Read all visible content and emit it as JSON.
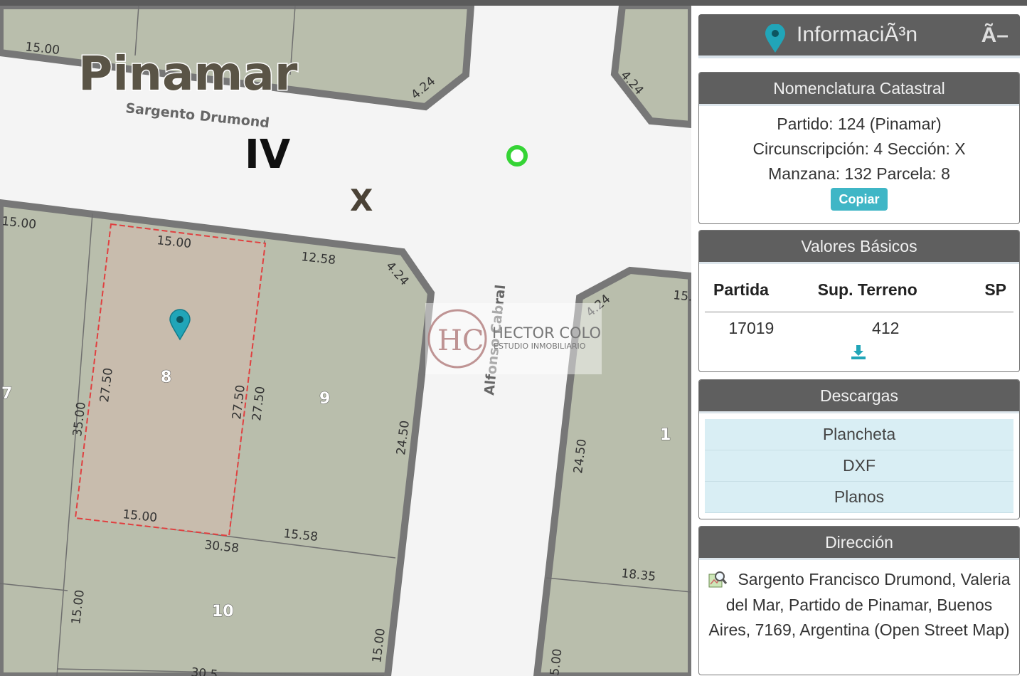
{
  "map": {
    "city_label": "Pinamar",
    "circunscripcion_label": "IV",
    "seccion_label": "X",
    "streets": [
      "Sargento Drumond",
      "Alfonso Cabral"
    ],
    "lots": [
      "8",
      "9",
      "10",
      "7",
      "1"
    ],
    "dimensions": [
      "15.00",
      "4.24",
      "4.24",
      "15.00",
      "15.00",
      "12.58",
      "4.24",
      "4.24",
      "15.",
      "27.50",
      "27.50",
      "27.50",
      "35.00",
      "24.50",
      "24.50",
      "15.00",
      "15.58",
      "30.58",
      "18.35",
      "15.00",
      "15.00",
      "5.00",
      "30.5"
    ],
    "watermark": {
      "title": "HECTOR COLO",
      "subtitle": "ESTUDIO INMOBILIARIO",
      "monogram": "HC"
    },
    "colors": {
      "parcel_fill": "#b9b3a2",
      "selected_fill": "#d4c3b3",
      "road": "#f4f4f4",
      "border": "#777777",
      "selection": "#e04040",
      "marker_green": "#35d435",
      "marker_teal": "#21a5b8"
    },
    "icons": [
      "map-pin-icon",
      "location-circle-icon"
    ]
  },
  "panel": {
    "title": "InformaciÃ³n",
    "minimize_symbol": "Ã–",
    "nomenclatura": {
      "heading": "Nomenclatura Catastral",
      "line1": "Partido: 124 (Pinamar)",
      "line2": "Circunscripción: 4 Sección: X",
      "line3": "Manzana: 132 Parcela: 8",
      "copy_label": "Copiar"
    },
    "valores": {
      "heading": "Valores Básicos",
      "columns": [
        "Partida",
        "Sup. Terreno",
        "SP"
      ],
      "row": [
        "17019",
        "412",
        ""
      ]
    },
    "descargas": {
      "heading": "Descargas",
      "items": [
        "Plancheta",
        "DXF",
        "Planos"
      ]
    },
    "direccion": {
      "heading": "Dirección",
      "text": "Sargento Francisco Drumond, Valeria del Mar, Partido de Pinamar, Buenos Aires, 7169, Argentina (Open Street Map)"
    }
  }
}
